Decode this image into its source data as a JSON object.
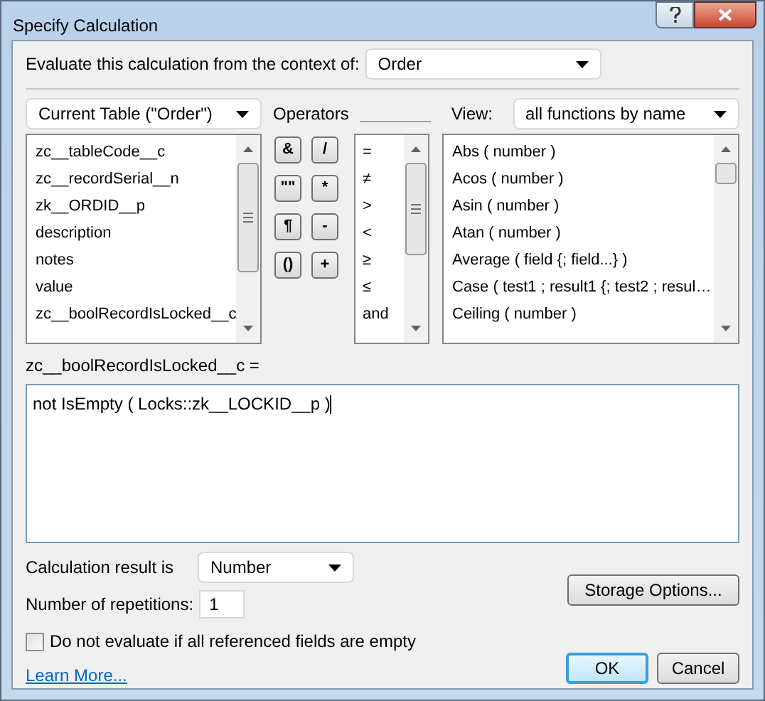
{
  "window": {
    "title": "Specify Calculation"
  },
  "context": {
    "label": "Evaluate this calculation from the context of:",
    "value": "Order"
  },
  "table_select": {
    "value": "Current Table (\"Order\")"
  },
  "fields": [
    "zc__tableCode__c",
    "zc__recordSerial__n",
    "zk__ORDID__p",
    "description",
    "notes",
    "value",
    "zc__boolRecordIsLocked__c"
  ],
  "operators_label": "Operators",
  "operator_buttons": [
    "&",
    "/",
    "\"\"",
    "*",
    "¶",
    "-",
    "()",
    "+"
  ],
  "operators": [
    "=",
    "≠",
    ">",
    "<",
    "≥",
    "≤",
    "and"
  ],
  "view": {
    "label": "View:",
    "value": "all functions by name"
  },
  "functions": [
    "Abs ( number )",
    "Acos ( number )",
    "Asin ( number )",
    "Atan ( number )",
    "Average ( field {; field...} )",
    "Case ( test1 ; result1 {; test2 ; resul…",
    "Ceiling ( number )"
  ],
  "formula_label": "zc__boolRecordIsLocked__c =",
  "formula": "not IsEmpty ( Locks::zk__LOCKID__p )",
  "result": {
    "label": "Calculation result is",
    "value": "Number"
  },
  "repetitions": {
    "label": "Number of repetitions:",
    "value": "1"
  },
  "storage_button": "Storage Options...",
  "do_not_evaluate": {
    "label": "Do not evaluate if all referenced fields are empty",
    "checked": false
  },
  "learn_more": "Learn More...",
  "buttons": [
    {
      "label": "OK",
      "default": true
    },
    {
      "label": "Cancel",
      "default": false
    }
  ]
}
